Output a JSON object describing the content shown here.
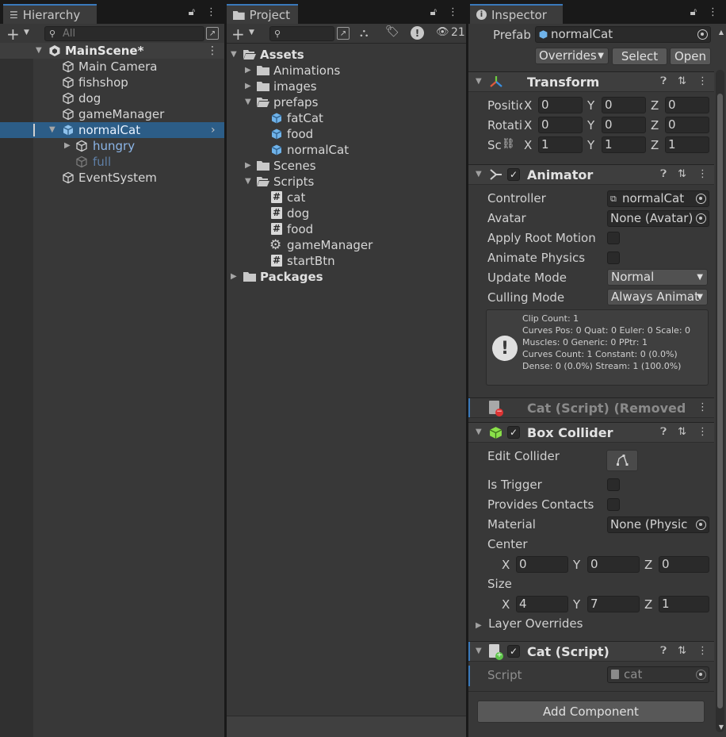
{
  "hierarchy": {
    "tab_title": "Hierarchy",
    "search_placeholder": "All",
    "scene_name": "MainScene*",
    "items": [
      {
        "label": "Main Camera"
      },
      {
        "label": "fishshop"
      },
      {
        "label": "dog"
      },
      {
        "label": "gameManager"
      },
      {
        "label": "normalCat"
      },
      {
        "label": "hungry"
      },
      {
        "label": "full"
      },
      {
        "label": "EventSystem"
      }
    ]
  },
  "project": {
    "tab_title": "Project",
    "hidden_count": "21",
    "items": [
      {
        "label": "Assets"
      },
      {
        "label": "Animations"
      },
      {
        "label": "images"
      },
      {
        "label": "prefaps"
      },
      {
        "label": "fatCat"
      },
      {
        "label": "food"
      },
      {
        "label": "normalCat"
      },
      {
        "label": "Scenes"
      },
      {
        "label": "Scripts"
      },
      {
        "label": "cat"
      },
      {
        "label": "dog"
      },
      {
        "label": "food"
      },
      {
        "label": "gameManager"
      },
      {
        "label": "startBtn"
      },
      {
        "label": "Packages"
      }
    ]
  },
  "inspector": {
    "tab_title": "Inspector",
    "prefab_label": "Prefab",
    "prefab_value": "normalCat",
    "overrides_label": "Overrides",
    "select_label": "Select",
    "open_label": "Open",
    "transform": {
      "title": "Transform",
      "position_label": "Positic",
      "rotation_label": "Rotatic",
      "scale_label": "Sc",
      "position": {
        "x": "0",
        "y": "0",
        "z": "0"
      },
      "rotation": {
        "x": "0",
        "y": "0",
        "z": "0"
      },
      "scale": {
        "x": "1",
        "y": "1",
        "z": "1"
      }
    },
    "animator": {
      "title": "Animator",
      "controller_label": "Controller",
      "controller_value": "normalCat",
      "avatar_label": "Avatar",
      "avatar_value": "None (Avatar)",
      "apply_root_motion_label": "Apply Root Motion",
      "animate_physics_label": "Animate Physics",
      "update_mode_label": "Update Mode",
      "update_mode_value": "Normal",
      "culling_mode_label": "Culling Mode",
      "culling_mode_value": "Always Animat",
      "info_lines": [
        "Clip Count: 1",
        "Curves Pos: 0 Quat: 0 Euler: 0 Scale: 0",
        "Muscles: 0 Generic: 0 PPtr: 1",
        "Curves Count: 1 Constant: 0 (0.0%)",
        "Dense: 0 (0.0%) Stream: 1 (100.0%)"
      ]
    },
    "removed_script": {
      "title": "Cat (Script) (Removed"
    },
    "box_collider": {
      "title": "Box Collider",
      "edit_collider_label": "Edit Collider",
      "is_trigger_label": "Is Trigger",
      "provides_contacts_label": "Provides Contacts",
      "material_label": "Material",
      "material_value": "None (Physic",
      "center_label": "Center",
      "center": {
        "x": "0",
        "y": "0",
        "z": "0"
      },
      "size_label": "Size",
      "size": {
        "x": "4",
        "y": "7",
        "z": "1"
      },
      "layer_overrides_label": "Layer Overrides"
    },
    "cat_script": {
      "title": "Cat (Script)",
      "script_label": "Script",
      "script_value": "cat"
    },
    "add_component_label": "Add Component",
    "axis": {
      "x": "X",
      "y": "Y",
      "z": "Z"
    }
  },
  "colors": {
    "selection": "#2c5d87",
    "tab_accent": "#3a79bb",
    "panel_bg": "#383838"
  }
}
